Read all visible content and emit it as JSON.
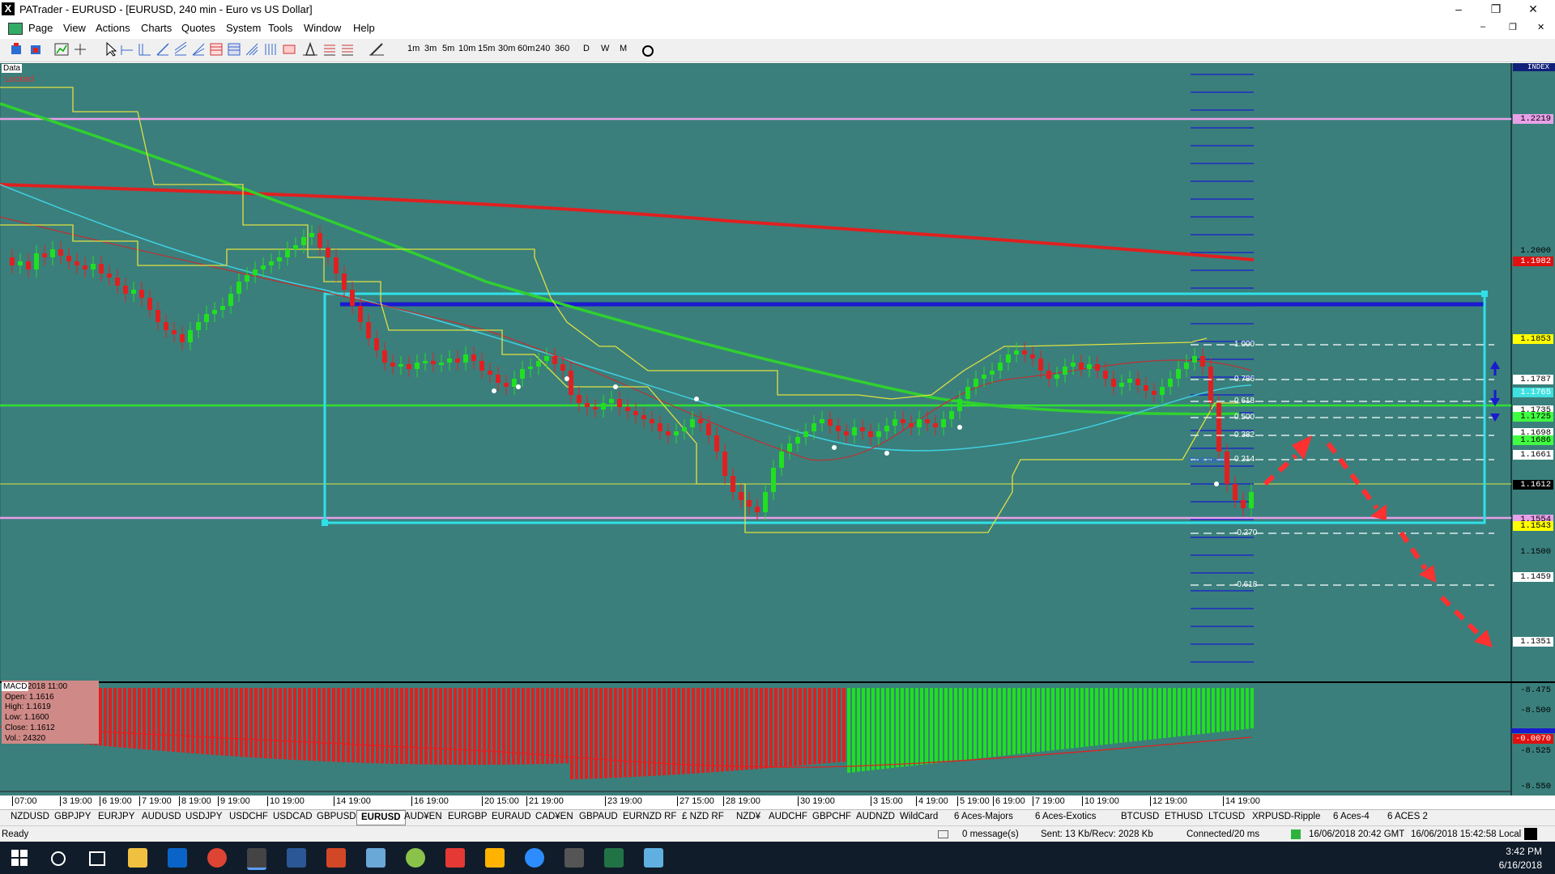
{
  "window": {
    "title": "PATrader - EURUSD - [EURUSD, 240 min - Euro vs US Dollar]",
    "app_icon": "X",
    "minimize": "–",
    "maximize": "❐",
    "close": "✕"
  },
  "menu": [
    "Page",
    "View",
    "Actions",
    "Charts",
    "Quotes",
    "System",
    "Tools",
    "Window",
    "Help"
  ],
  "timeframes": [
    "1m",
    "3m",
    "5m",
    "10m",
    "15m",
    "30m",
    "60m",
    "240",
    "360",
    "D",
    "W",
    "M"
  ],
  "chart": {
    "corner_label": "Data",
    "locked_label": "Locked",
    "index_label": "INDEX",
    "price_labels": [
      {
        "value": "1.2219",
        "bg": "#e8a0e8",
        "fg": "#000"
      },
      {
        "value": "1.2000",
        "bg": "",
        "fg": "#000"
      },
      {
        "value": "1.1982",
        "bg": "#e01010",
        "fg": "#fff"
      },
      {
        "value": "1.1853",
        "bg": "#ffff00",
        "fg": "#000"
      },
      {
        "value": "1.1787",
        "bg": "#ffffff",
        "fg": "#000"
      },
      {
        "value": "1.1765",
        "bg": "#40e0e0",
        "fg": "#fff"
      },
      {
        "value": "1.1735",
        "bg": "#ffffff",
        "fg": "#000"
      },
      {
        "value": "1.1725",
        "bg": "#40ff40",
        "fg": "#000"
      },
      {
        "value": "1.1698",
        "bg": "#ffffff",
        "fg": "#000"
      },
      {
        "value": "1.1686",
        "bg": "#40ff40",
        "fg": "#000"
      },
      {
        "value": "1.1661",
        "bg": "#ffffff",
        "fg": "#000"
      },
      {
        "value": "1.1612",
        "bg": "#000000",
        "fg": "#fff"
      },
      {
        "value": "1.1554",
        "bg": "#e8a0e8",
        "fg": "#000"
      },
      {
        "value": "1.1543",
        "bg": "#ffff00",
        "fg": "#000"
      },
      {
        "value": "1.1500",
        "bg": "",
        "fg": "#000"
      },
      {
        "value": "1.1459",
        "bg": "#ffffff",
        "fg": "#000"
      },
      {
        "value": "1.1351",
        "bg": "#ffffff",
        "fg": "#000"
      }
    ],
    "fib_levels": [
      "1.000",
      "0.786",
      "0.618",
      "0.500",
      "0.382",
      "0.214",
      "-0.270",
      "-0.618"
    ],
    "grid_base_label": "Grid Base",
    "ohlc": {
      "date": "15/06/2018 11:00",
      "open": "Open: 1.1616",
      "high": "High: 1.1619",
      "low": "Low: 1.1600",
      "close": "Close: 1.1612",
      "vol": "Vol.: 24320"
    },
    "macd_label": "MACD",
    "macd_labels": [
      {
        "value": "-8.475",
        "bg": "",
        "fg": "#000"
      },
      {
        "value": "-8.500",
        "bg": "",
        "fg": "#000"
      },
      {
        "value": "-8.525",
        "bg": "",
        "fg": "#000"
      },
      {
        "value": "-8.550",
        "bg": "",
        "fg": "#000"
      },
      {
        "value": "-0.0070",
        "bg": "#e01010",
        "fg": "#fff"
      }
    ],
    "time_labels": [
      "07:00",
      "3 19:00",
      "6 19:00",
      "7 19:00",
      "8 19:00",
      "9 19:00",
      "10 19:00",
      "14 19:00",
      "16 19:00",
      "20 15:00",
      "21 19:00",
      "23 19:00",
      "27 15:00",
      "28 19:00",
      "30 19:00",
      "3 15:00",
      "4 19:00",
      "5 19:00",
      "6 19:00",
      "7 19:00",
      "10 19:00",
      "12 19:00",
      "14 19:00"
    ]
  },
  "symbol_tabs": [
    "NZDUSD",
    "GBPJPY",
    "EURJPY",
    "AUDUSD",
    "USDJPY",
    "USDCHF",
    "USDCAD",
    "GBPUSD",
    "EURUSD",
    "AUD¥EN",
    "EURGBP",
    "EURAUD",
    "CAD¥EN",
    "GBPAUD",
    "EURNZD RF",
    "£ NZD RF",
    "NZD¥",
    "AUDCHF",
    "GBPCHF",
    "AUDNZD",
    "WildCard",
    "6 Aces-Majors",
    "6 Aces-Exotics",
    "BTCUSD",
    "ETHUSD",
    "LTCUSD",
    "XRPUSD-Ripple",
    "6 Aces-4",
    "6 ACES 2"
  ],
  "active_tab": "EURUSD",
  "status": {
    "ready": "Ready",
    "messages": "0 message(s)",
    "traffic": "Sent: 13 Kb/Recv: 2028 Kb",
    "connection": "Connected/20 ms",
    "gmt": "16/06/2018 20:42 GMT",
    "local": "16/06/2018 15:42:58 Local"
  },
  "taskbar": {
    "time": "3:42 PM",
    "date": "6/16/2018"
  }
}
